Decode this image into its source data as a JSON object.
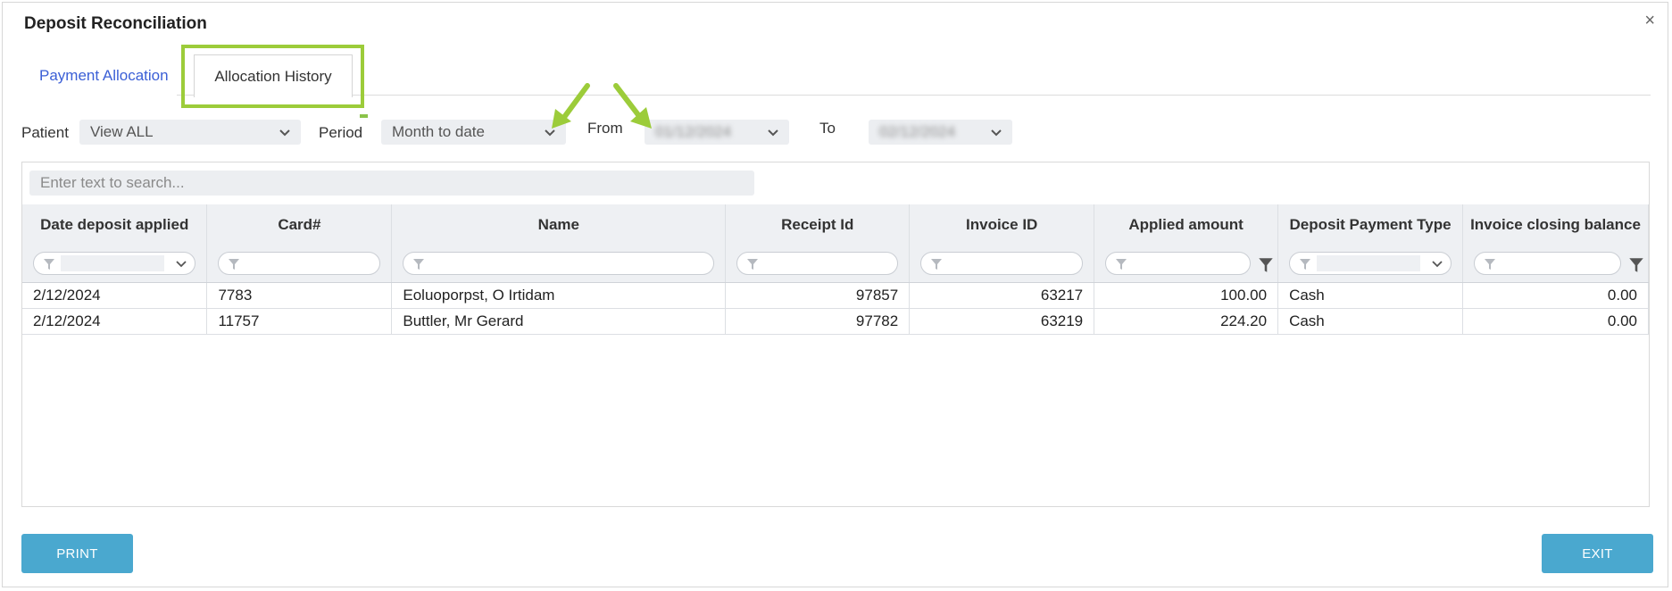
{
  "dialog": {
    "title": "Deposit Reconciliation",
    "close_glyph": "×"
  },
  "tabs": [
    {
      "label": "Payment Allocation",
      "active": false
    },
    {
      "label": "Allocation History",
      "active": true
    }
  ],
  "filters": {
    "patient_label": "Patient",
    "patient_value": "View ALL",
    "period_label": "Period",
    "period_value": "Month to date",
    "from_label": "From",
    "from_value": "01/12/2024",
    "to_label": "To",
    "to_value": "02/12/2024"
  },
  "search": {
    "placeholder": "Enter text to search..."
  },
  "table": {
    "columns": [
      "Date deposit applied",
      "Card#",
      "Name",
      "Receipt Id",
      "Invoice ID",
      "Applied amount",
      "Deposit Payment Type",
      "Invoice closing balance"
    ],
    "rows": [
      [
        "2/12/2024",
        "7783",
        "Eoluoporpst, O Irtidam",
        "97857",
        "63217",
        "100.00",
        "Cash",
        "0.00"
      ],
      [
        "2/12/2024",
        "11757",
        "Buttler, Mr Gerard",
        "97782",
        "63219",
        "224.20",
        "Cash",
        "0.00"
      ]
    ]
  },
  "buttons": {
    "print": "PRINT",
    "exit": "EXIT"
  },
  "colors": {
    "accent": "#4aa8cf",
    "tab_link": "#3b5fd6",
    "highlight": "#9ccc3a"
  },
  "icons": [
    "close-icon",
    "chevron-down-icon",
    "filter-funnel-icon",
    "annotation-arrow-icon"
  ]
}
